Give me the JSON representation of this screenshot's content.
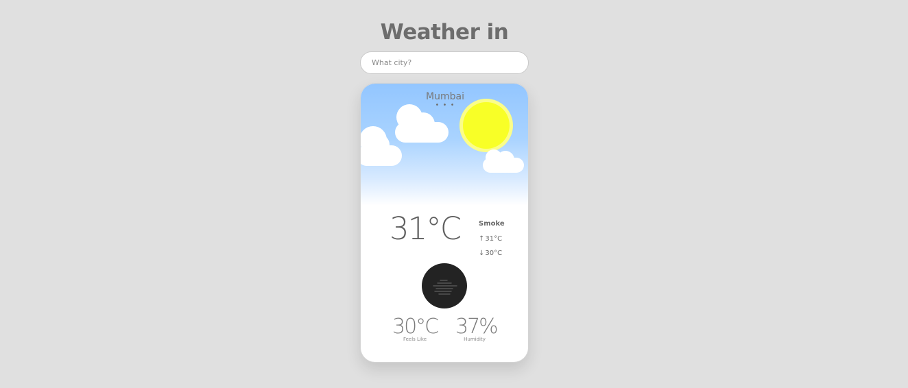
{
  "header": {
    "title": "Weather in"
  },
  "search": {
    "placeholder": "What city?",
    "value": ""
  },
  "weather": {
    "city": "Mumbai",
    "loading_dots": "• • •",
    "temperature": "31°C",
    "description": "Smoke",
    "high_arrow": "↑",
    "high": "31°C",
    "low_arrow": "↓",
    "low": "30°C",
    "icon": "smoke-icon",
    "feels_like": "30°C",
    "feels_like_label": "Feels Like",
    "humidity": "37%",
    "humidity_label": "Humidity"
  },
  "colors": {
    "background": "#e0e0e0",
    "sky_top": "#93c6ff",
    "sun": "#f8ff27",
    "icon_circle": "#232323"
  }
}
